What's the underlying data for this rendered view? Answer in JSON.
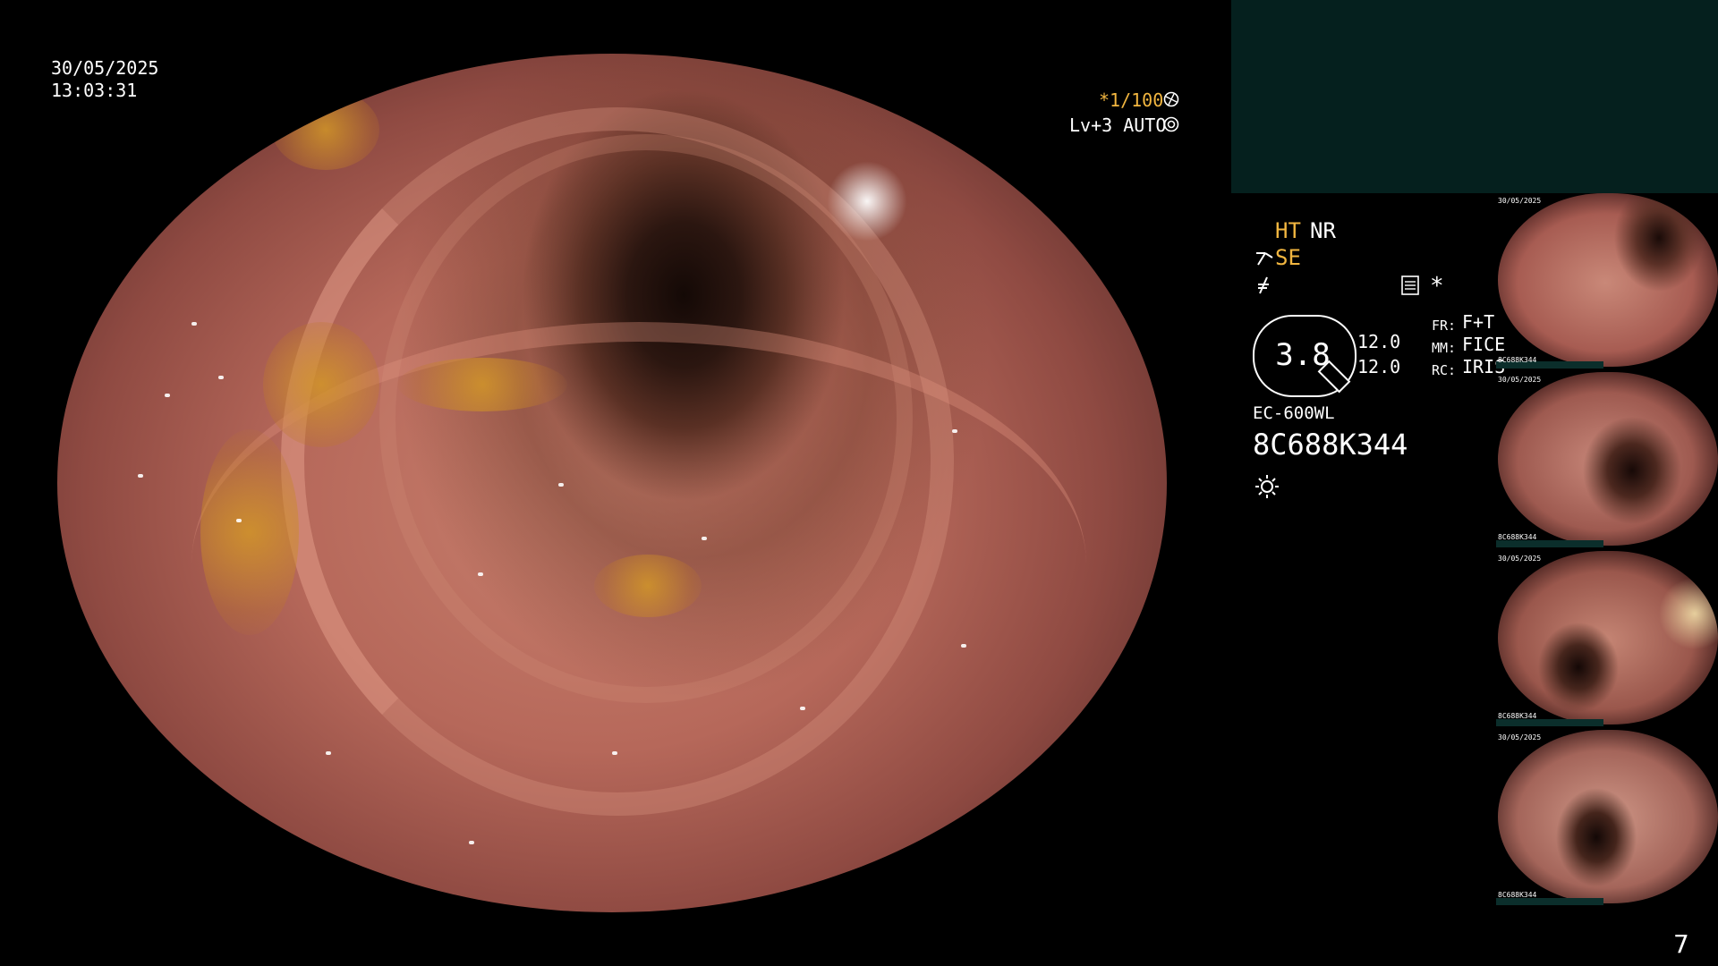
{
  "overlay": {
    "date": "30/05/2025",
    "time": "13:03:31",
    "shutter": "*1/100",
    "level": "Lv+3 AUTO",
    "shutter_icon": "aperture-icon",
    "auto_icon": "iris-icon"
  },
  "settings": {
    "ht": "HT",
    "nr": "NR",
    "se": "SE",
    "freeze_icon": "freeze-icon",
    "capture_icon": "capture-icon",
    "asterisk": "*",
    "zoom": "3.8",
    "val1": "12.0",
    "val2": "12.0",
    "fr_key": "FR:",
    "fr_val": "F+T",
    "mm_key": "MM:",
    "mm_val": "FICE",
    "rc_key": "RC:",
    "rc_val": "IRIS",
    "model": "EC-600WL",
    "serial": "8C688K344",
    "light_icon": "light-icon"
  },
  "thumbnails": [
    {
      "date": "30/05/2025",
      "serial": "8C688K344"
    },
    {
      "date": "30/05/2025",
      "serial": "8C688K344"
    },
    {
      "date": "30/05/2025",
      "serial": "8C688K344"
    },
    {
      "date": "30/05/2025",
      "serial": "8C688K344"
    }
  ],
  "page_number": "7",
  "colors": {
    "accent": "#f2b640",
    "status_box": "#05201e"
  }
}
